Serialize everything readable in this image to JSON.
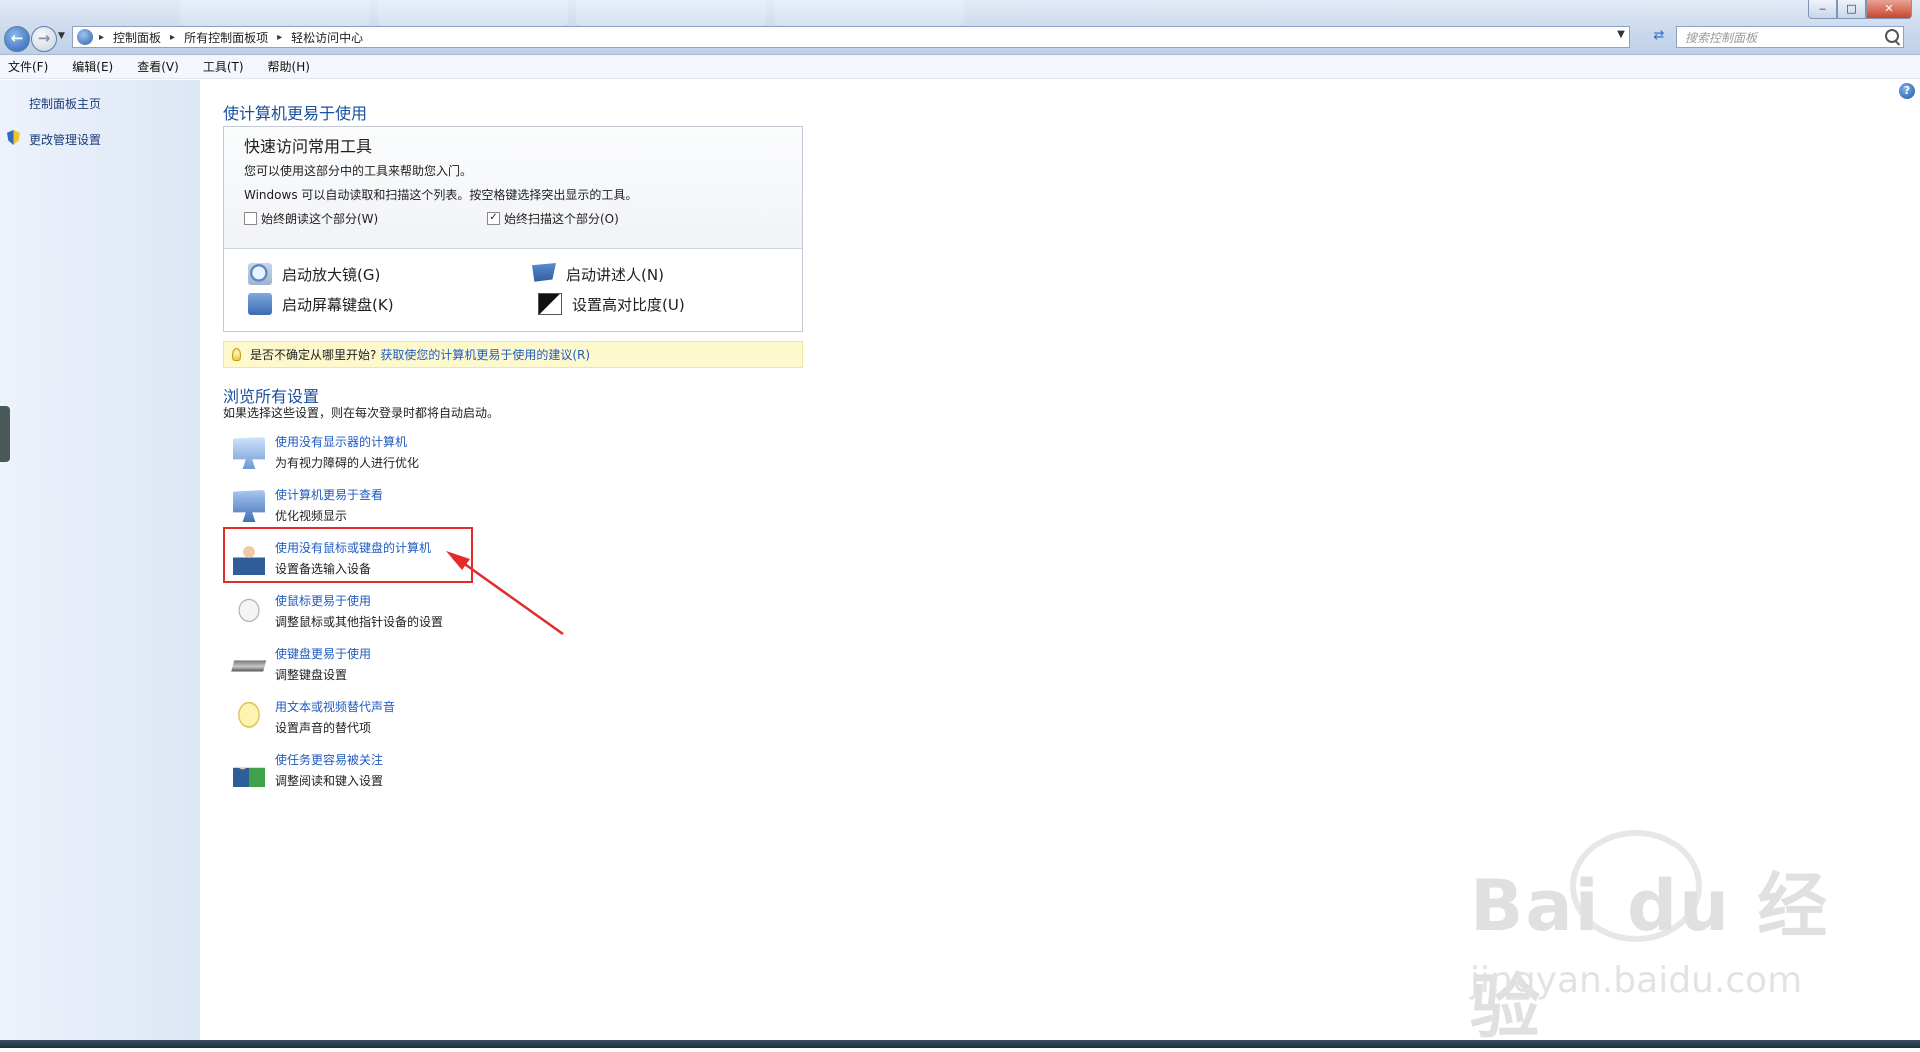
{
  "window": {
    "minimize": "‒",
    "maximize": "□",
    "close": "✕"
  },
  "address": {
    "icon": "control-panel-icon",
    "crumbs": [
      "控制面板",
      "所有控制面板项",
      "轻松访问中心"
    ],
    "separator": "▸"
  },
  "search": {
    "placeholder": "搜索控制面板"
  },
  "menu": [
    "文件(F)",
    "编辑(E)",
    "查看(V)",
    "工具(T)",
    "帮助(H)"
  ],
  "sidebar": {
    "home": "控制面板主页",
    "admin": "更改管理设置"
  },
  "main": {
    "title": "使计算机更易于使用",
    "quick": {
      "heading": "快速访问常用工具",
      "desc1": "您可以使用这部分中的工具来帮助您入门。",
      "desc2": "Windows 可以自动读取和扫描这个列表。按空格键选择突出显示的工具。",
      "checkbox_read": {
        "label": "始终朗读这个部分(W)",
        "checked": false
      },
      "checkbox_scan": {
        "label": "始终扫描这个部分(O)",
        "checked": true
      },
      "tools": {
        "magnifier": "启动放大镜(G)",
        "narrator": "启动讲述人(N)",
        "keyboard": "启动屏幕键盘(K)",
        "contrast": "设置高对比度(U)"
      }
    },
    "tip": {
      "text": "是否不确定从哪里开始?",
      "link": "获取使您的计算机更易于使用的建议(R)"
    },
    "browse": {
      "title": "浏览所有设置",
      "desc": "如果选择这些设置，则在每次登录时都将自动启动。",
      "items": [
        {
          "link": "使用没有显示器的计算机",
          "sub": "为有视力障碍的人进行优化"
        },
        {
          "link": "使计算机更易于查看",
          "sub": "优化视频显示"
        },
        {
          "link": "使用没有鼠标或键盘的计算机",
          "sub": "设置备选输入设备"
        },
        {
          "link": "使鼠标更易于使用",
          "sub": "调整鼠标或其他指针设备的设置"
        },
        {
          "link": "使键盘更易于使用",
          "sub": "调整键盘设置"
        },
        {
          "link": "用文本或视频替代声音",
          "sub": "设置声音的替代项"
        },
        {
          "link": "使任务更容易被关注",
          "sub": "调整阅读和键入设置"
        }
      ]
    }
  },
  "watermark": {
    "brand": "Bai du 经验",
    "url": "jingyan.baidu.com"
  },
  "colors": {
    "link": "#1f5bbf",
    "heading": "#1b4fa0",
    "highlight": "#e32b2b",
    "tip_bg": "#fdf9cd"
  }
}
